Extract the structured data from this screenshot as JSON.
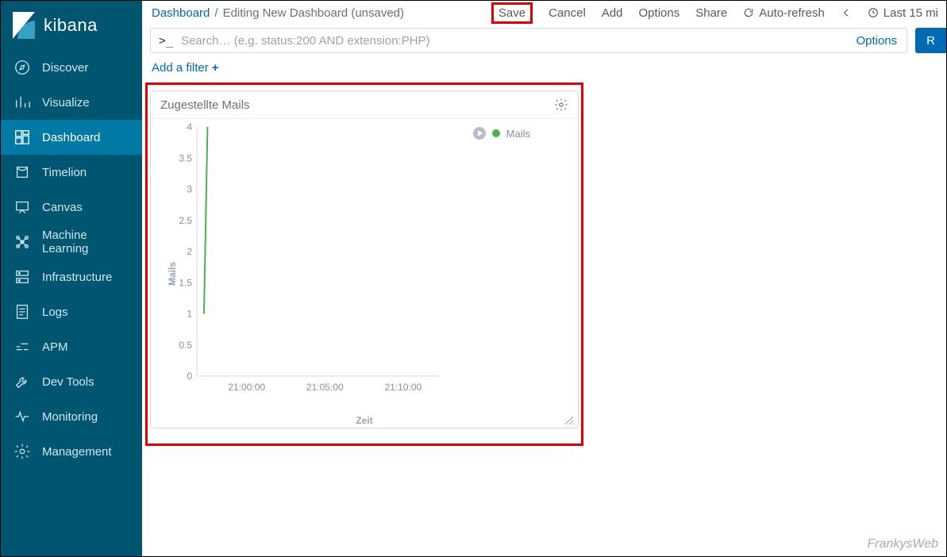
{
  "brand": "kibana",
  "sidebar": {
    "items": [
      {
        "label": "Discover"
      },
      {
        "label": "Visualize"
      },
      {
        "label": "Dashboard"
      },
      {
        "label": "Timelion"
      },
      {
        "label": "Canvas"
      },
      {
        "label": "Machine Learning"
      },
      {
        "label": "Infrastructure"
      },
      {
        "label": "Logs"
      },
      {
        "label": "APM"
      },
      {
        "label": "Dev Tools"
      },
      {
        "label": "Monitoring"
      },
      {
        "label": "Management"
      }
    ],
    "active_index": 2
  },
  "breadcrumb": {
    "root": "Dashboard",
    "sep": "/",
    "current": "Editing New Dashboard (unsaved)"
  },
  "toolbar": {
    "save": "Save",
    "cancel": "Cancel",
    "add": "Add",
    "options": "Options",
    "share": "Share",
    "autorefresh": "Auto-refresh",
    "timerange": "Last 15 mi"
  },
  "search": {
    "prompt": ">_",
    "placeholder": "Search… (e.g. status:200 AND extension:PHP)",
    "options_label": "Options",
    "run_label": "R"
  },
  "filters": {
    "add_label": "Add a filter"
  },
  "panel": {
    "title": "Zugestellte Mails",
    "legend_series": "Mails",
    "ylabel": "Mails",
    "xlabel": "Zeit"
  },
  "chart_data": {
    "type": "line",
    "title": "Zugestellte Mails",
    "xlabel": "Zeit",
    "ylabel": "Mails",
    "ylim": [
      0,
      4
    ],
    "yticks": [
      0,
      0.5,
      1,
      1.5,
      2,
      2.5,
      3,
      3.5,
      4
    ],
    "xticks": [
      "21:00:00",
      "21:05:00",
      "21:10:00"
    ],
    "series": [
      {
        "name": "Mails",
        "color": "#4caf50",
        "x": [
          "20:57:30",
          "20:58:00"
        ],
        "values": [
          1,
          4
        ]
      }
    ]
  },
  "watermark": "FrankysWeb"
}
